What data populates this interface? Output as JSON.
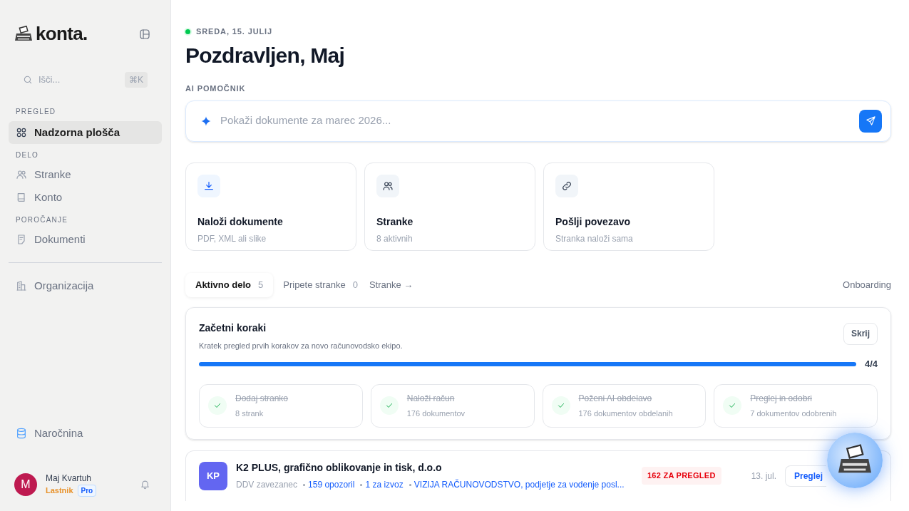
{
  "sidebar": {
    "logo": "konta.",
    "search": {
      "placeholder": "Išči...",
      "shortcut": "⌘K"
    },
    "sections": [
      {
        "heading": "PREGLED",
        "items": [
          {
            "label": "Nadzorna plošča",
            "selected": true
          }
        ]
      },
      {
        "heading": "DELO",
        "items": [
          {
            "label": "Stranke",
            "selected": false
          },
          {
            "label": "Konto",
            "selected": false
          }
        ]
      },
      {
        "heading": "POROČANJE",
        "items": [
          {
            "label": "Dokumenti",
            "selected": false
          }
        ]
      },
      {
        "items": [
          {
            "label": "Organizacija",
            "selected": false
          }
        ]
      }
    ],
    "subscription": "Naročnina",
    "user": {
      "initial": "M",
      "name": "Maj Kvartuh",
      "role": "Lastnik",
      "plan": "Pro"
    }
  },
  "header": {
    "date": "SREDA, 15. JULIJ",
    "greeting": "Pozdravljen, Maj"
  },
  "assistant": {
    "label": "AI POMOČNIK",
    "placeholder": "Pokaži dokumente za marec 2026..."
  },
  "actions": [
    {
      "title": "Naloži dokumente",
      "subtitle": "PDF, XML ali slike"
    },
    {
      "title": "Stranke",
      "subtitle": "8 aktivnih"
    },
    {
      "title": "Pošlji povezavo",
      "subtitle": "Stranka naloži sama"
    }
  ],
  "tabs": [
    {
      "label": "Aktivno delo",
      "count": "5",
      "selected": true
    },
    {
      "label": "Pripete stranke",
      "count": "0",
      "selected": false
    }
  ],
  "tabs_link": "Stranke →",
  "onboarding_link": "Onboarding",
  "onboarding": {
    "title": "Začetni koraki",
    "subtitle": "Kratek pregled prvih korakov za novo računovodsko ekipo.",
    "hide": "Skrij",
    "level": 1,
    "progress": "4/4",
    "steps": [
      {
        "title": "Dodaj stranko",
        "detail": "8 strank",
        "done": true
      },
      {
        "title": "Naloži račun",
        "detail": "176 dokumentov",
        "done": true
      },
      {
        "title": "Poženi AI obdelavo",
        "detail": "176 dokumentov obdelanih",
        "done": true
      },
      {
        "title": "Preglej in odobri",
        "detail": "7 dokumentov odobrenih",
        "done": true
      }
    ]
  },
  "clients": [
    {
      "initials": "KP",
      "color": "#6366f1",
      "name": "K2 PLUS, grafično oblikovanje in tisk, d.o.o",
      "tax": "DDV zavezanec",
      "links": [
        "159 opozoril",
        "1 za izvoz",
        "VIZIJA RAČUNOVODSTVO, podjetje za vodenje posl..."
      ],
      "badge": "162 ZA PREGLED",
      "date": "13. jul.",
      "button": "Preglej"
    }
  ]
}
